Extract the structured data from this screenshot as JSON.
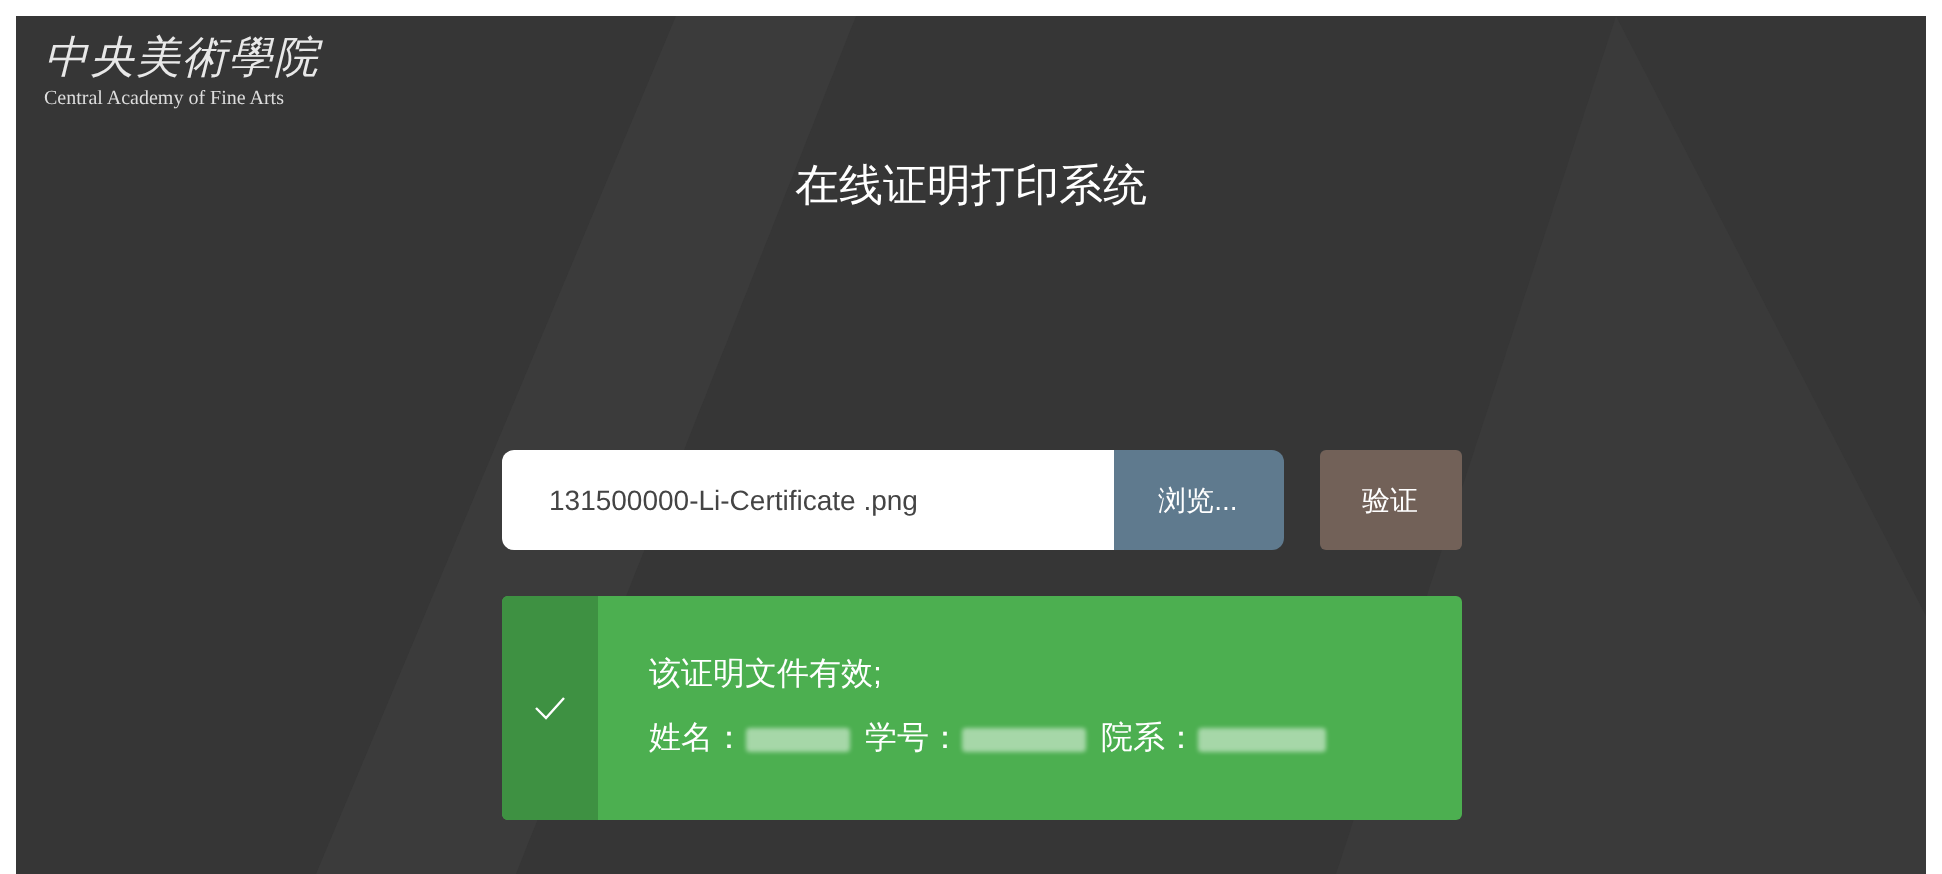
{
  "logo": {
    "name_cn": "中央美術學院",
    "name_en": "Central Academy of Fine Arts"
  },
  "title": "在线证明打印系统",
  "file_field": {
    "value": "131500000-Li-Certificate .png"
  },
  "browse_button": "浏览...",
  "verify_button": "验证",
  "result": {
    "kind": "success",
    "message": "该证明文件有效;",
    "fields": [
      {
        "label": "姓名："
      },
      {
        "label": "学号："
      },
      {
        "label": "院系："
      }
    ]
  }
}
